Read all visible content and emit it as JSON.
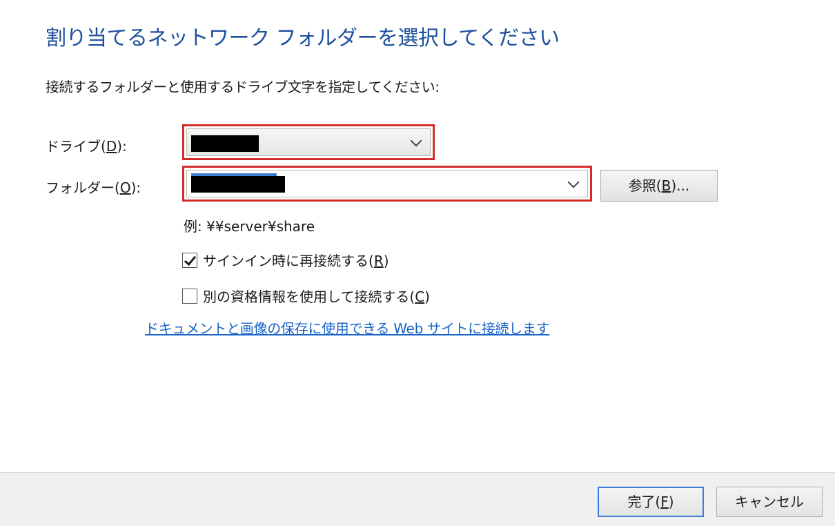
{
  "dialog": {
    "title": "割り当てるネットワーク フォルダーを選択してください",
    "instruction": "接続するフォルダーと使用するドライブ文字を指定してください:",
    "drive": {
      "label_prefix": "ドライブ(",
      "label_key": "D",
      "label_suffix": "):",
      "value": ""
    },
    "folder": {
      "label_prefix": "フォルダー(",
      "label_key": "O",
      "label_suffix": "):",
      "value": ""
    },
    "browse_button": {
      "prefix": "参照(",
      "key": "B",
      "suffix": ")..."
    },
    "example": "例: ¥¥server¥share",
    "reconnect": {
      "prefix": "サインイン時に再接続する(",
      "key": "R",
      "suffix": ")",
      "checked": true
    },
    "credentials": {
      "prefix": "別の資格情報を使用して接続する(",
      "key": "C",
      "suffix": ")",
      "checked": false
    },
    "link": "ドキュメントと画像の保存に使用できる Web サイトに接続します",
    "footer": {
      "finish": {
        "prefix": "完了(",
        "key": "F",
        "suffix": ")"
      },
      "cancel": "キャンセル"
    },
    "colors": {
      "title": "#1c4f9c",
      "link": "#1a64c8",
      "highlight": "#d42a2a",
      "default_button_border": "#3c7fd8"
    }
  }
}
